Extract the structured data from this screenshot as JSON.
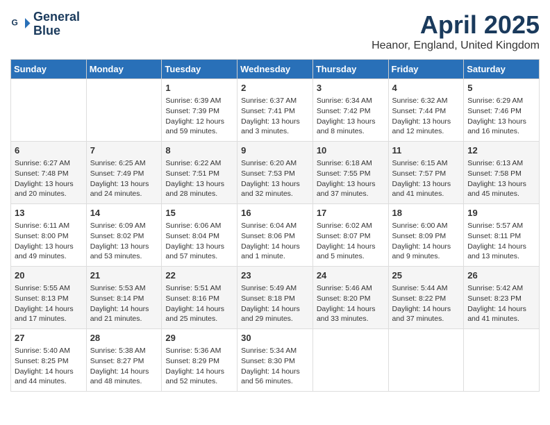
{
  "logo": {
    "line1": "General",
    "line2": "Blue"
  },
  "title": "April 2025",
  "location": "Heanor, England, United Kingdom",
  "days_of_week": [
    "Sunday",
    "Monday",
    "Tuesday",
    "Wednesday",
    "Thursday",
    "Friday",
    "Saturday"
  ],
  "weeks": [
    [
      {
        "day": "",
        "info": ""
      },
      {
        "day": "",
        "info": ""
      },
      {
        "day": "1",
        "info": "Sunrise: 6:39 AM\nSunset: 7:39 PM\nDaylight: 12 hours and 59 minutes."
      },
      {
        "day": "2",
        "info": "Sunrise: 6:37 AM\nSunset: 7:41 PM\nDaylight: 13 hours and 3 minutes."
      },
      {
        "day": "3",
        "info": "Sunrise: 6:34 AM\nSunset: 7:42 PM\nDaylight: 13 hours and 8 minutes."
      },
      {
        "day": "4",
        "info": "Sunrise: 6:32 AM\nSunset: 7:44 PM\nDaylight: 13 hours and 12 minutes."
      },
      {
        "day": "5",
        "info": "Sunrise: 6:29 AM\nSunset: 7:46 PM\nDaylight: 13 hours and 16 minutes."
      }
    ],
    [
      {
        "day": "6",
        "info": "Sunrise: 6:27 AM\nSunset: 7:48 PM\nDaylight: 13 hours and 20 minutes."
      },
      {
        "day": "7",
        "info": "Sunrise: 6:25 AM\nSunset: 7:49 PM\nDaylight: 13 hours and 24 minutes."
      },
      {
        "day": "8",
        "info": "Sunrise: 6:22 AM\nSunset: 7:51 PM\nDaylight: 13 hours and 28 minutes."
      },
      {
        "day": "9",
        "info": "Sunrise: 6:20 AM\nSunset: 7:53 PM\nDaylight: 13 hours and 32 minutes."
      },
      {
        "day": "10",
        "info": "Sunrise: 6:18 AM\nSunset: 7:55 PM\nDaylight: 13 hours and 37 minutes."
      },
      {
        "day": "11",
        "info": "Sunrise: 6:15 AM\nSunset: 7:57 PM\nDaylight: 13 hours and 41 minutes."
      },
      {
        "day": "12",
        "info": "Sunrise: 6:13 AM\nSunset: 7:58 PM\nDaylight: 13 hours and 45 minutes."
      }
    ],
    [
      {
        "day": "13",
        "info": "Sunrise: 6:11 AM\nSunset: 8:00 PM\nDaylight: 13 hours and 49 minutes."
      },
      {
        "day": "14",
        "info": "Sunrise: 6:09 AM\nSunset: 8:02 PM\nDaylight: 13 hours and 53 minutes."
      },
      {
        "day": "15",
        "info": "Sunrise: 6:06 AM\nSunset: 8:04 PM\nDaylight: 13 hours and 57 minutes."
      },
      {
        "day": "16",
        "info": "Sunrise: 6:04 AM\nSunset: 8:06 PM\nDaylight: 14 hours and 1 minute."
      },
      {
        "day": "17",
        "info": "Sunrise: 6:02 AM\nSunset: 8:07 PM\nDaylight: 14 hours and 5 minutes."
      },
      {
        "day": "18",
        "info": "Sunrise: 6:00 AM\nSunset: 8:09 PM\nDaylight: 14 hours and 9 minutes."
      },
      {
        "day": "19",
        "info": "Sunrise: 5:57 AM\nSunset: 8:11 PM\nDaylight: 14 hours and 13 minutes."
      }
    ],
    [
      {
        "day": "20",
        "info": "Sunrise: 5:55 AM\nSunset: 8:13 PM\nDaylight: 14 hours and 17 minutes."
      },
      {
        "day": "21",
        "info": "Sunrise: 5:53 AM\nSunset: 8:14 PM\nDaylight: 14 hours and 21 minutes."
      },
      {
        "day": "22",
        "info": "Sunrise: 5:51 AM\nSunset: 8:16 PM\nDaylight: 14 hours and 25 minutes."
      },
      {
        "day": "23",
        "info": "Sunrise: 5:49 AM\nSunset: 8:18 PM\nDaylight: 14 hours and 29 minutes."
      },
      {
        "day": "24",
        "info": "Sunrise: 5:46 AM\nSunset: 8:20 PM\nDaylight: 14 hours and 33 minutes."
      },
      {
        "day": "25",
        "info": "Sunrise: 5:44 AM\nSunset: 8:22 PM\nDaylight: 14 hours and 37 minutes."
      },
      {
        "day": "26",
        "info": "Sunrise: 5:42 AM\nSunset: 8:23 PM\nDaylight: 14 hours and 41 minutes."
      }
    ],
    [
      {
        "day": "27",
        "info": "Sunrise: 5:40 AM\nSunset: 8:25 PM\nDaylight: 14 hours and 44 minutes."
      },
      {
        "day": "28",
        "info": "Sunrise: 5:38 AM\nSunset: 8:27 PM\nDaylight: 14 hours and 48 minutes."
      },
      {
        "day": "29",
        "info": "Sunrise: 5:36 AM\nSunset: 8:29 PM\nDaylight: 14 hours and 52 minutes."
      },
      {
        "day": "30",
        "info": "Sunrise: 5:34 AM\nSunset: 8:30 PM\nDaylight: 14 hours and 56 minutes."
      },
      {
        "day": "",
        "info": ""
      },
      {
        "day": "",
        "info": ""
      },
      {
        "day": "",
        "info": ""
      }
    ]
  ]
}
